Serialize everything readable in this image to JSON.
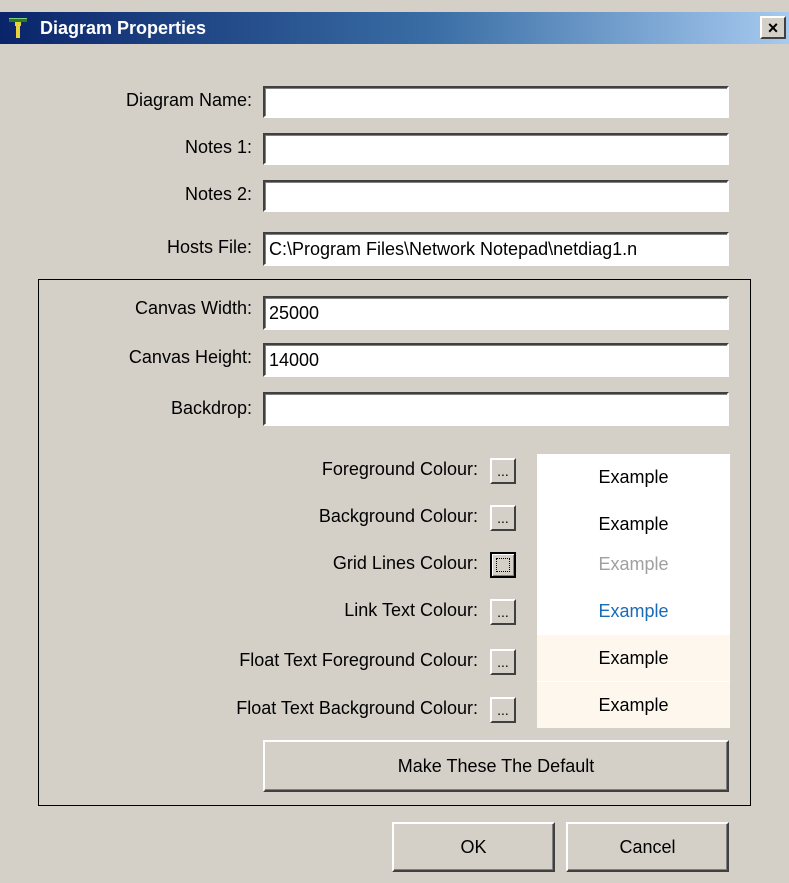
{
  "window": {
    "title": "Diagram Properties",
    "close_label": "×"
  },
  "fields": {
    "diagram_name": {
      "label": "Diagram Name:",
      "value": ""
    },
    "notes1": {
      "label": "Notes 1:",
      "value": ""
    },
    "notes2": {
      "label": "Notes 2:",
      "value": ""
    },
    "hosts_file": {
      "label": "Hosts File:",
      "value": "C:\\Program Files\\Network Notepad\\netdiag1.n"
    }
  },
  "canvas": {
    "width": {
      "label": "Canvas Width:",
      "value": "25000"
    },
    "height": {
      "label": "Canvas Height:",
      "value": "14000"
    },
    "backdrop": {
      "label": "Backdrop:",
      "value": ""
    }
  },
  "colours": [
    {
      "label": "Foreground Colour:",
      "button": "...",
      "example": "Example",
      "text_color": "#000000",
      "bg_color": "#ffffff"
    },
    {
      "label": "Background Colour:",
      "button": "...",
      "example": "Example",
      "text_color": "#000000",
      "bg_color": "#ffffff"
    },
    {
      "label": "Grid Lines Colour:",
      "button": "",
      "example": "Example",
      "text_color": "#a0a0a0",
      "bg_color": "#ffffff"
    },
    {
      "label": "Link Text Colour:",
      "button": "...",
      "example": "Example",
      "text_color": "#1a6bb5",
      "bg_color": "#ffffff"
    },
    {
      "label": "Float Text Foreground Colour:",
      "button": "...",
      "example": "Example",
      "text_color": "#000000",
      "bg_color": "#fdf7ee"
    },
    {
      "label": "Float Text Background Colour:",
      "button": "...",
      "example": "Example",
      "text_color": "#000000",
      "bg_color": "#fdf7ee"
    }
  ],
  "buttons": {
    "make_default": "Make These The Default",
    "ok": "OK",
    "cancel": "Cancel"
  },
  "colors": {
    "titlebar_start": "#0a246a",
    "titlebar_end": "#a6caf0",
    "dialog_bg": "#d4d0c8"
  }
}
